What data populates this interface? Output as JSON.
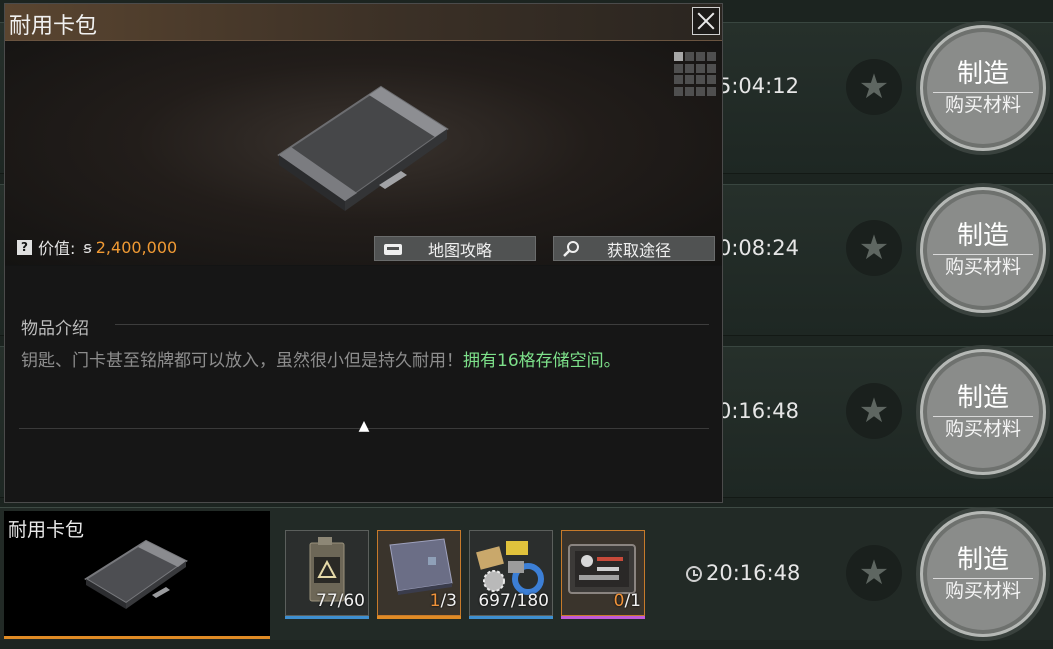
{
  "popup": {
    "title": "耐用卡包",
    "value_label": "价值:",
    "value_amount": "2,400,000",
    "map_guide_label": "地图攻略",
    "obtain_label": "获取途径",
    "desc_header": "物品介绍",
    "desc_text": "钥匙、门卡甚至铭牌都可以放入，虽然很小但是持久耐用！",
    "desc_highlight": "拥有16格存储空间。"
  },
  "rows": [
    {
      "time": "5:04:12",
      "make_label": "制造",
      "buy_label": "购买材料"
    },
    {
      "time": "0:08:24",
      "make_label": "制造",
      "buy_label": "购买材料"
    },
    {
      "time": "0:16:48",
      "make_label": "制造",
      "buy_label": "购买材料"
    },
    {
      "time": "20:16:48",
      "make_label": "制造",
      "buy_label": "购买材料"
    }
  ],
  "recipe": {
    "product_name": "耐用卡包",
    "materials": [
      {
        "icon": "fuel-can-icon",
        "have": "77",
        "need": "/60",
        "bar_color": "#3e8fd0"
      },
      {
        "icon": "folder-card-icon",
        "have": "1",
        "need": "/3",
        "bar_color": "#e08b25"
      },
      {
        "icon": "tape-parts-icon",
        "have": "697",
        "need": "/180",
        "bar_color": "#3e8fd0"
      },
      {
        "icon": "toolbox-icon",
        "have": "0",
        "need": "/1",
        "bar_color": "#c25bd8"
      }
    ]
  },
  "colors": {
    "accent_orange": "#f09a34",
    "highlight_green": "#7de08a"
  }
}
